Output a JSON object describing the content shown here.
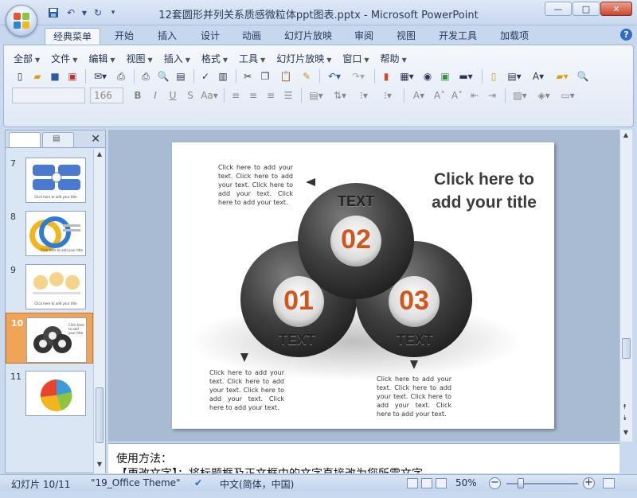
{
  "window": {
    "title": "12套圆形并列关系质感微粒体ppt图表.pptx - Microsoft PowerPoint",
    "minimize": "—",
    "maximize": "□",
    "close": "✕"
  },
  "quick_access": [
    "save-icon",
    "undo-icon",
    "redo-icon",
    "customize-icon"
  ],
  "ribbon_tabs": [
    "经典菜单",
    "开始",
    "插入",
    "设计",
    "动画",
    "幻灯片放映",
    "审阅",
    "视图",
    "开发工具",
    "加载项"
  ],
  "menu": [
    "全部",
    "文件",
    "编辑",
    "视图",
    "插入",
    "格式",
    "工具",
    "幻灯片放映",
    "窗口",
    "帮助"
  ],
  "font": {
    "name": "",
    "size": "166"
  },
  "slides_pane": {
    "thumbnails": [
      {
        "num": "7",
        "caption": "Click here to add your title"
      },
      {
        "num": "8",
        "caption": "Click here to add your title"
      },
      {
        "num": "9",
        "caption": "Click here to add your title"
      },
      {
        "num": "10",
        "caption": "Click here to add your title"
      },
      {
        "num": "11",
        "caption": ""
      }
    ]
  },
  "slide": {
    "title": "Click here to add your title",
    "label_01": "01",
    "label_02": "02",
    "label_03": "03",
    "text_top": "TEXT",
    "text_left": "TEXT",
    "text_right": "TEXT",
    "body_top": "Click here to add your text. Click here to add your text. Click here to add your text. Click here to add your text.",
    "body_left": "Click here to add your text. Click here to add your text. Click here to add your text. Click here to add your text.",
    "body_right": "Click here to add your text. Click here to add your text. Click here to add your text. Click here to add your text.",
    "accent_color": "#d0561c"
  },
  "notes": {
    "line1": "使用方法：",
    "line2": "【更改文字】：将标题框及正文框中的文字直接改为您所需文字"
  },
  "status": {
    "slide_index": "幻灯片 10/11",
    "theme": "\"19_Office Theme\"",
    "language": "中文(简体，中国)",
    "zoom": "50%"
  }
}
